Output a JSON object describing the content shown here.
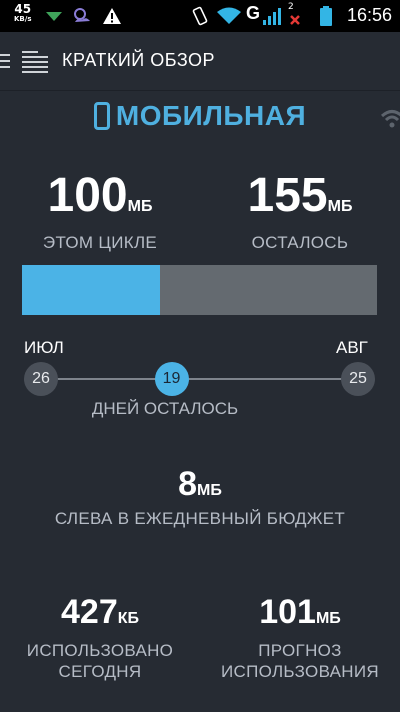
{
  "status_bar": {
    "speed": "45",
    "speed_unit": "KB/s",
    "network_letter": "G",
    "sim_badge": "2",
    "time": "16:56"
  },
  "app_bar": {
    "title": "КРАТКИЙ ОБЗОР"
  },
  "network": {
    "title": "МОБИЛЬНАЯ",
    "accent_color": "#4bb3e6"
  },
  "cycle": {
    "used": {
      "value": "100",
      "unit": "МБ",
      "label": "ЭТОМ ЦИКЛЕ"
    },
    "left": {
      "value": "155",
      "unit": "МБ",
      "label": "ОСТАЛОСЬ"
    },
    "used_fraction": 0.39
  },
  "timeline": {
    "start_month": "ИЮЛ",
    "end_month": "АВГ",
    "start_day": "26",
    "current_day": "19",
    "end_day": "25",
    "current_position_fraction": 0.41,
    "days_left_label": "ДНЕЙ ОСТАЛОСЬ"
  },
  "daily_budget": {
    "value": "8",
    "unit": "МБ",
    "label": "СЛЕВА В ЕЖЕДНЕВНЫЙ БЮДЖЕТ"
  },
  "today": {
    "value": "427",
    "unit": "КБ",
    "label_line1": "ИСПОЛЬЗОВАНО",
    "label_line2": "СЕГОДНЯ"
  },
  "forecast": {
    "value": "101",
    "unit": "МБ",
    "label_line1": "ПРОГНОЗ",
    "label_line2": "ИСПОЛЬЗОВАНИЯ"
  }
}
